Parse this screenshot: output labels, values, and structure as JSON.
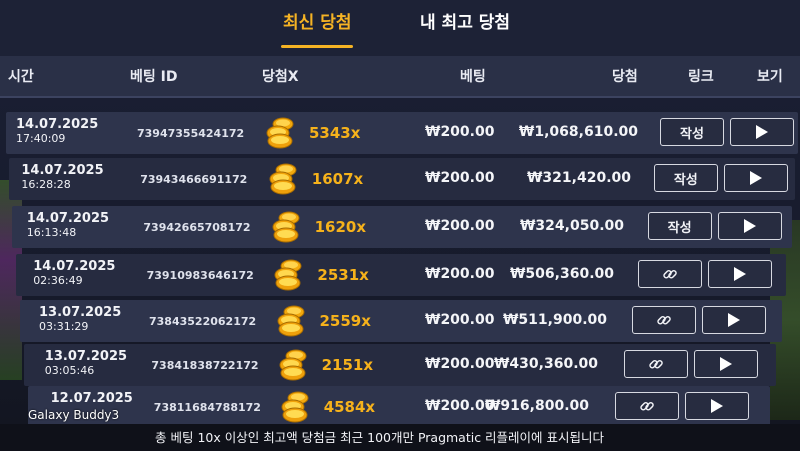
{
  "tabs": [
    {
      "label": "최신 당첨",
      "active": true
    },
    {
      "label": "내 최고 당첨",
      "active": false
    }
  ],
  "columns": {
    "time": "시간",
    "bet_id": "베팅 ID",
    "win_x": "당첨X",
    "bet": "베팅",
    "win": "당첨",
    "link": "링크",
    "view": "보기"
  },
  "rows": [
    {
      "date": "14.07.2025",
      "time": "17:40:09",
      "bet_id": "73947355424172",
      "multiplier": "5343x",
      "bet": "₩200.00",
      "win": "₩1,068,610.00",
      "link_type": "text",
      "link_label": "작성"
    },
    {
      "date": "14.07.2025",
      "time": "16:28:28",
      "bet_id": "73943466691172",
      "multiplier": "1607x",
      "bet": "₩200.00",
      "win": "₩321,420.00",
      "link_type": "text",
      "link_label": "작성"
    },
    {
      "date": "14.07.2025",
      "time": "16:13:48",
      "bet_id": "73942665708172",
      "multiplier": "1620x",
      "bet": "₩200.00",
      "win": "₩324,050.00",
      "link_type": "text",
      "link_label": "작성"
    },
    {
      "date": "14.07.2025",
      "time": "02:36:49",
      "bet_id": "73910983646172",
      "multiplier": "2531x",
      "bet": "₩200.00",
      "win": "₩506,360.00",
      "link_type": "icon",
      "link_label": ""
    },
    {
      "date": "13.07.2025",
      "time": "03:31:29",
      "bet_id": "73843522062172",
      "multiplier": "2559x",
      "bet": "₩200.00",
      "win": "₩511,900.00",
      "link_type": "icon",
      "link_label": ""
    },
    {
      "date": "13.07.2025",
      "time": "03:05:46",
      "bet_id": "73841838722172",
      "multiplier": "2151x",
      "bet": "₩200.00",
      "win": "₩430,360.00",
      "link_type": "icon",
      "link_label": ""
    },
    {
      "date": "12.07.2025",
      "time": "",
      "bet_id": "73811684788172",
      "multiplier": "4584x",
      "bet": "₩200.00",
      "win": "₩916,800.00",
      "link_type": "icon",
      "link_label": ""
    }
  ],
  "footer": {
    "note": "총 베팅 10x 이상인 최고액 당첨금 최근 100개만 Pragmatic 리플레이에 표시됩니다"
  },
  "overlay": {
    "camera_label": "Galaxy Buddy3"
  },
  "icons": {
    "coin": "gold-coins-icon",
    "link": "chain-link-icon",
    "view": "play-icon"
  },
  "colors": {
    "accent": "#f5b324",
    "multiplier": "#f6b21b",
    "row_odd": "#2e344c",
    "row_even": "#262b40",
    "header": "#2a3047"
  }
}
